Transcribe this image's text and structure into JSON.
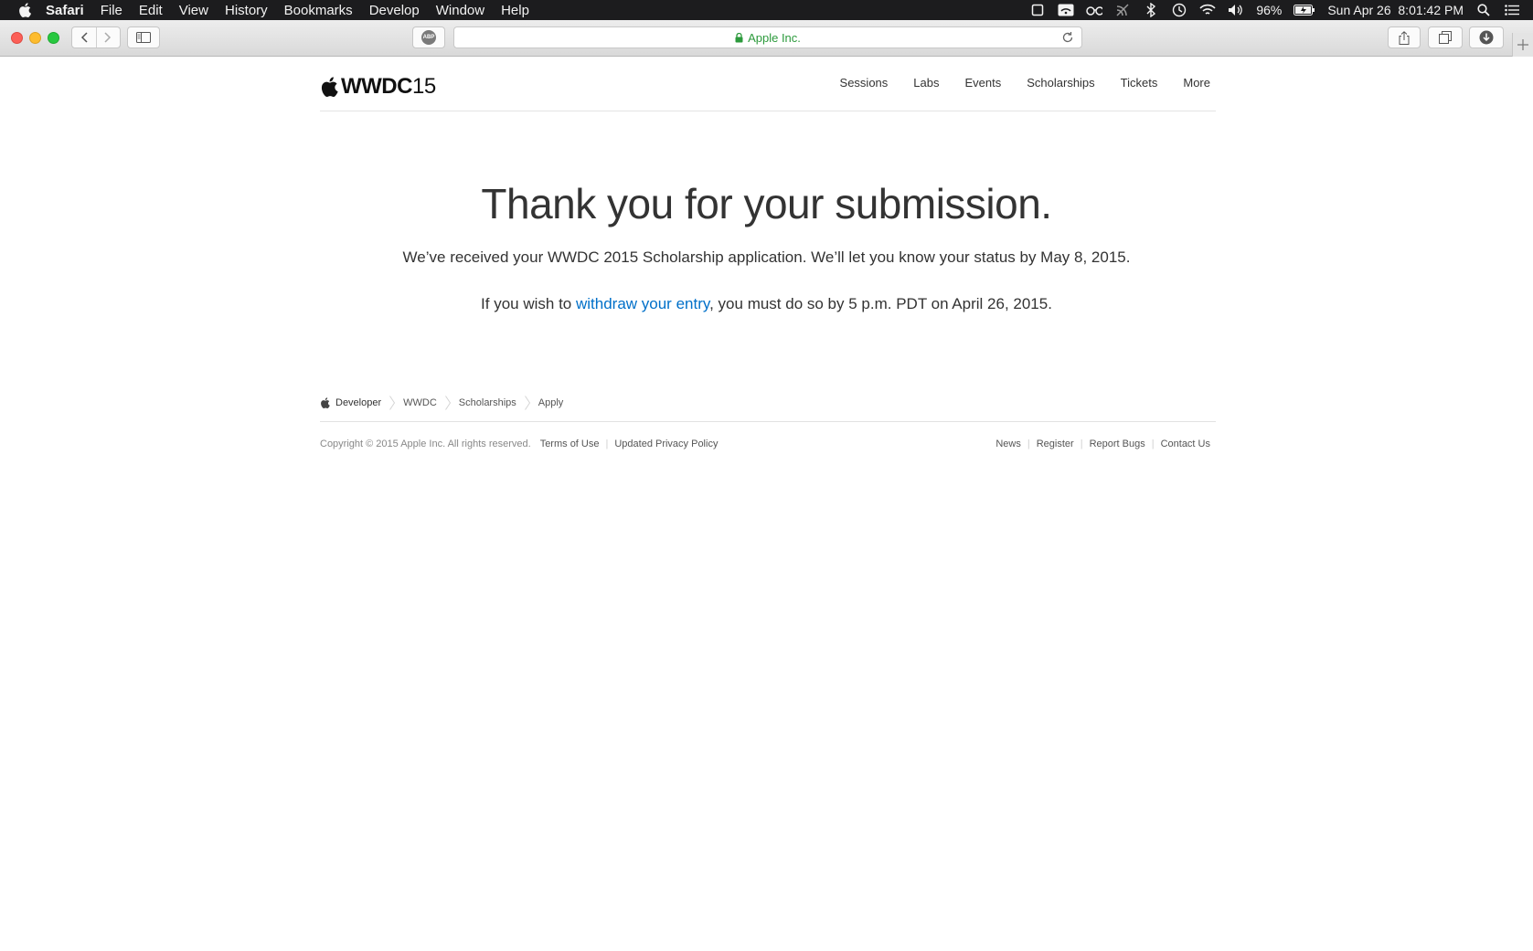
{
  "menubar": {
    "app_name": "Safari",
    "items": [
      "File",
      "Edit",
      "View",
      "History",
      "Bookmarks",
      "Develop",
      "Window",
      "Help"
    ],
    "battery": "96%",
    "datetime": "Sun Apr 26  8:01:42 PM"
  },
  "toolbar": {
    "address_label": "Apple Inc.",
    "adblock_label": "ABP"
  },
  "site": {
    "logo_primary": "WWDC",
    "logo_secondary": "15",
    "nav": [
      "Sessions",
      "Labs",
      "Events",
      "Scholarships",
      "Tickets",
      "More"
    ]
  },
  "main": {
    "title": "Thank you for your submission.",
    "line1": "We’ve received your WWDC 2015 Scholarship application. We’ll let you know your status by May 8, 2015.",
    "line2_before": "If you wish to ",
    "line2_link": "withdraw your entry",
    "line2_after": ", you must do so by 5 p.m. PDT on April 26, 2015."
  },
  "breadcrumbs": [
    "Developer",
    "WWDC",
    "Scholarships",
    "Apply"
  ],
  "footer": {
    "copyright": "Copyright © 2015 Apple Inc. All rights reserved.",
    "left_links": [
      "Terms of Use",
      "Updated Privacy Policy"
    ],
    "right_links": [
      "News",
      "Register",
      "Report Bugs",
      "Contact Us"
    ]
  }
}
